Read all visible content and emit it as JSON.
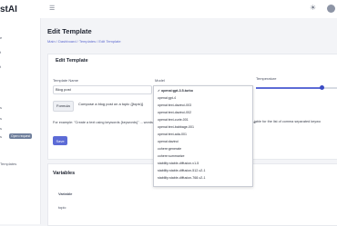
{
  "app": {
    "logo_text": "stAI"
  },
  "sidebar": {
    "lines": [
      "e",
      "t",
      "t",
      "s",
      "s",
      "s",
      "s"
    ],
    "badge": "Open request",
    "templates_label": "Templates"
  },
  "page": {
    "title": "Edit Template",
    "breadcrumb": "Main  /  Dashboard  /  Templates  /  Edit Template"
  },
  "form": {
    "section_title": "Edit Template",
    "template_name_label": "Template Name",
    "template_name_value": "Blog post",
    "model_label": "Model",
    "temperature_label": "Temperature",
    "temperature_fraction": 0.82,
    "formula_tab": "Formula",
    "prompt_value": "Compose a blog post on a topic {{topic}}",
    "helper_text": "For example: \"Create a text using keywords {keywords}\" ... words will be a number of words. User will be asked to fill these variables.",
    "helper_right": "iable for the list of comma separated keywo",
    "save_label": "Save"
  },
  "model_dropdown": {
    "selected": "openai:gpt-3.5-turbo",
    "options": [
      "openai:gpt-3.5-turbo",
      "openai:gpt-4",
      "openai:text-davinci-003",
      "openai:text-davinci-002",
      "openai:text-curie-001",
      "openai:text-babbage-001",
      "openai:text-ada-001",
      "openai:davinci",
      "cohere:generate",
      "cohere:summarize",
      "stability:stable-diffusion-v1-5",
      "stability:stable-diffusion-512-v2-1",
      "stability:stable-diffusion-768-v2-1"
    ]
  },
  "variables": {
    "section_title": "Variables",
    "column_header": "Variable",
    "rows": [
      "topic"
    ]
  }
}
